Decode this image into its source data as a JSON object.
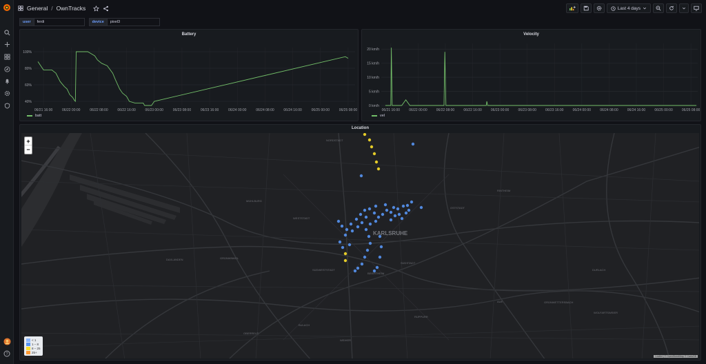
{
  "breadcrumb": {
    "folder": "General",
    "separator": "/",
    "dashboard": "OwnTracks"
  },
  "toolbar": {
    "time_range": "Last 4 days"
  },
  "variables": [
    {
      "label": "user",
      "value": "ferdi"
    },
    {
      "label": "device",
      "value": "pixel3"
    }
  ],
  "panels": {
    "battery": {
      "title": "Battery",
      "legend": "batt"
    },
    "velocity": {
      "title": "Velocity",
      "legend": "vel"
    },
    "location": {
      "title": "Location"
    }
  },
  "map": {
    "zoom_in": "+",
    "zoom_out": "−",
    "attribution": "Leaflet | © OpenStreetMap © CartoDB",
    "city_label": "KARLSRUHE",
    "district_labels": [
      "NORDSTADT",
      "MÜHLBURG",
      "WESTSTADT",
      "OSTSTADT",
      "DAXLANDEN",
      "GRÜNWINKEL",
      "SÜDWESTSTADT",
      "SÜDSTADT",
      "DURLACH",
      "BULACH",
      "OBERREUT",
      "WEIHER",
      "RINTHEIM",
      "AUE",
      "GRÜNWETTERSBACH",
      "WOLFARTSWEIER",
      "RÜPPURR",
      "BEIERTHEIM"
    ],
    "legend": [
      {
        "label": "< 1",
        "color": "#8ab8ff"
      },
      {
        "label": "1 – 8",
        "color": "#5794f2"
      },
      {
        "label": "8 – 25",
        "color": "#fade2a"
      },
      {
        "label": "25+",
        "color": "#ff9830"
      }
    ]
  },
  "colors": {
    "series": "#73bf69",
    "speed_low": "#5794f2",
    "speed_high": "#fade2a"
  },
  "chart_data": [
    {
      "type": "line",
      "title": "Battery",
      "ylabel": "",
      "xlabel": "",
      "yticks": [
        "40%",
        "60%",
        "80%",
        "100%"
      ],
      "ylim": [
        35,
        105
      ],
      "xticks": [
        "06/21 16:00",
        "06/22 00:00",
        "06/22 08:00",
        "06/22 16:00",
        "06/23 00:00",
        "06/23 08:00",
        "06/23 16:00",
        "06/24 00:00",
        "06/24 08:00",
        "06/24 16:00",
        "06/25 00:00",
        "06/25 08:00"
      ],
      "series": [
        {
          "name": "batt",
          "points": [
            [
              -0.2,
              88
            ],
            [
              0.0,
              78
            ],
            [
              0.3,
              78
            ],
            [
              0.45,
              74
            ],
            [
              0.6,
              64
            ],
            [
              0.75,
              58
            ],
            [
              0.85,
              55
            ],
            [
              0.95,
              48
            ],
            [
              1.05,
              45
            ],
            [
              1.1,
              42
            ],
            [
              1.15,
              40
            ],
            [
              1.18,
              100
            ],
            [
              1.6,
              100
            ],
            [
              1.7,
              98
            ],
            [
              1.85,
              95
            ],
            [
              1.95,
              90
            ],
            [
              2.1,
              86
            ],
            [
              2.3,
              83
            ],
            [
              2.5,
              74
            ],
            [
              2.6,
              66
            ],
            [
              2.75,
              55
            ],
            [
              2.85,
              50
            ],
            [
              3.0,
              46
            ],
            [
              3.1,
              40
            ],
            [
              3.3,
              38
            ],
            [
              3.6,
              38
            ],
            [
              3.65,
              35
            ],
            [
              3.9,
              35
            ],
            [
              4.0,
              40
            ],
            [
              10.9,
              94
            ],
            [
              11.0,
              92
            ]
          ]
        }
      ]
    },
    {
      "type": "line",
      "title": "Velocity",
      "ylabel": "",
      "xlabel": "",
      "yticks": [
        "0 km/h",
        "5 km/h",
        "10 km/h",
        "15 km/h",
        "20 km/h"
      ],
      "ylim": [
        0,
        22
      ],
      "xticks": [
        "06/21 16:00",
        "06/22 00:00",
        "06/22 08:00",
        "06/22 16:00",
        "06/23 00:00",
        "06/23 08:00",
        "06/23 16:00",
        "06/24 00:00",
        "06/24 08:00",
        "06/24 16:00",
        "06/25 00:00",
        "06/25 08:00"
      ],
      "series": [
        {
          "name": "vel",
          "points": [
            [
              -0.2,
              0
            ],
            [
              0.0,
              0
            ],
            [
              0.02,
              20.5
            ],
            [
              0.05,
              0
            ],
            [
              0.4,
              0
            ],
            [
              0.55,
              2
            ],
            [
              0.7,
              0
            ],
            [
              1.95,
              0
            ],
            [
              1.98,
              19
            ],
            [
              2.02,
              0
            ],
            [
              3.5,
              0
            ],
            [
              3.52,
              1.5
            ],
            [
              3.55,
              0
            ],
            [
              11.2,
              0
            ]
          ]
        }
      ]
    }
  ]
}
